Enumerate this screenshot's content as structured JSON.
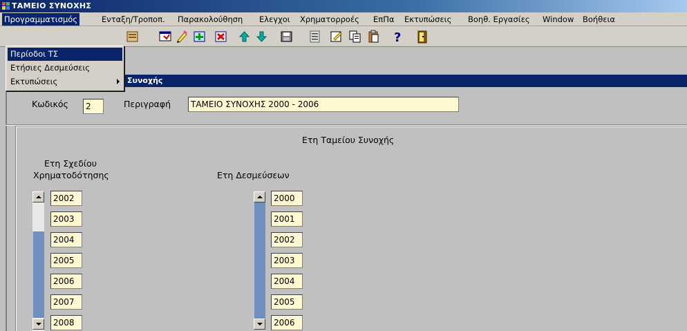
{
  "window": {
    "title": "ΤΑΜΕΙΟ ΣΥΝΟΧΗΣ",
    "icon": "app-grid-icon"
  },
  "menubar": {
    "items": [
      {
        "label": "Προγραμματισμός",
        "active": true
      },
      {
        "label": "Ενταξη/Τροποπ."
      },
      {
        "label": "Παρακολούθηση"
      },
      {
        "label": "Ελεγχοι"
      },
      {
        "label": "Χρηματορροές"
      },
      {
        "label": "ΕπΠα"
      },
      {
        "label": "Εκτυπώσεις"
      },
      {
        "label": "Βοηθ. Εργασίες"
      },
      {
        "label": "Window"
      },
      {
        "label": "Βοήθεια"
      }
    ]
  },
  "dropdown": {
    "items": [
      {
        "label": "Περίοδοι ΤΣ",
        "selected": true
      },
      {
        "label": "Ετήσιες Δεσμεύσεις"
      },
      {
        "label": "Εκτυπώσεις",
        "submenu": true
      }
    ]
  },
  "toolbar": {
    "buttons": [
      "database-icon",
      "edit-record-icon",
      "pencil-icon",
      "insert-record-icon",
      "delete-record-icon",
      "arrow-up-icon",
      "arrow-down-icon",
      "save-icon",
      "list-icon",
      "form-edit-icon",
      "copy-icon",
      "paste-icon",
      "help-icon",
      "exit-icon"
    ]
  },
  "inner": {
    "title": "Συνοχής",
    "code_label": "Κωδικός",
    "code_value": "2",
    "desc_label": "Περιγραφή",
    "desc_value": "ΤΑΜΕΙΟ ΣΥΝΟΧΗΣ 2000 - 2006",
    "group_title": "Ετη Ταμείου Συνοχής",
    "plan_years_label_1": "Ετη Σχεδίου",
    "plan_years_label_2": "Χρηματοδότησης",
    "commit_years_label": "Ετη Δεσμεύσεων",
    "plan_years": [
      "2002",
      "2003",
      "2004",
      "2005",
      "2006",
      "2007",
      "2008"
    ],
    "commit_years": [
      "2000",
      "2001",
      "2002",
      "2003",
      "2004",
      "2005",
      "2006"
    ]
  }
}
